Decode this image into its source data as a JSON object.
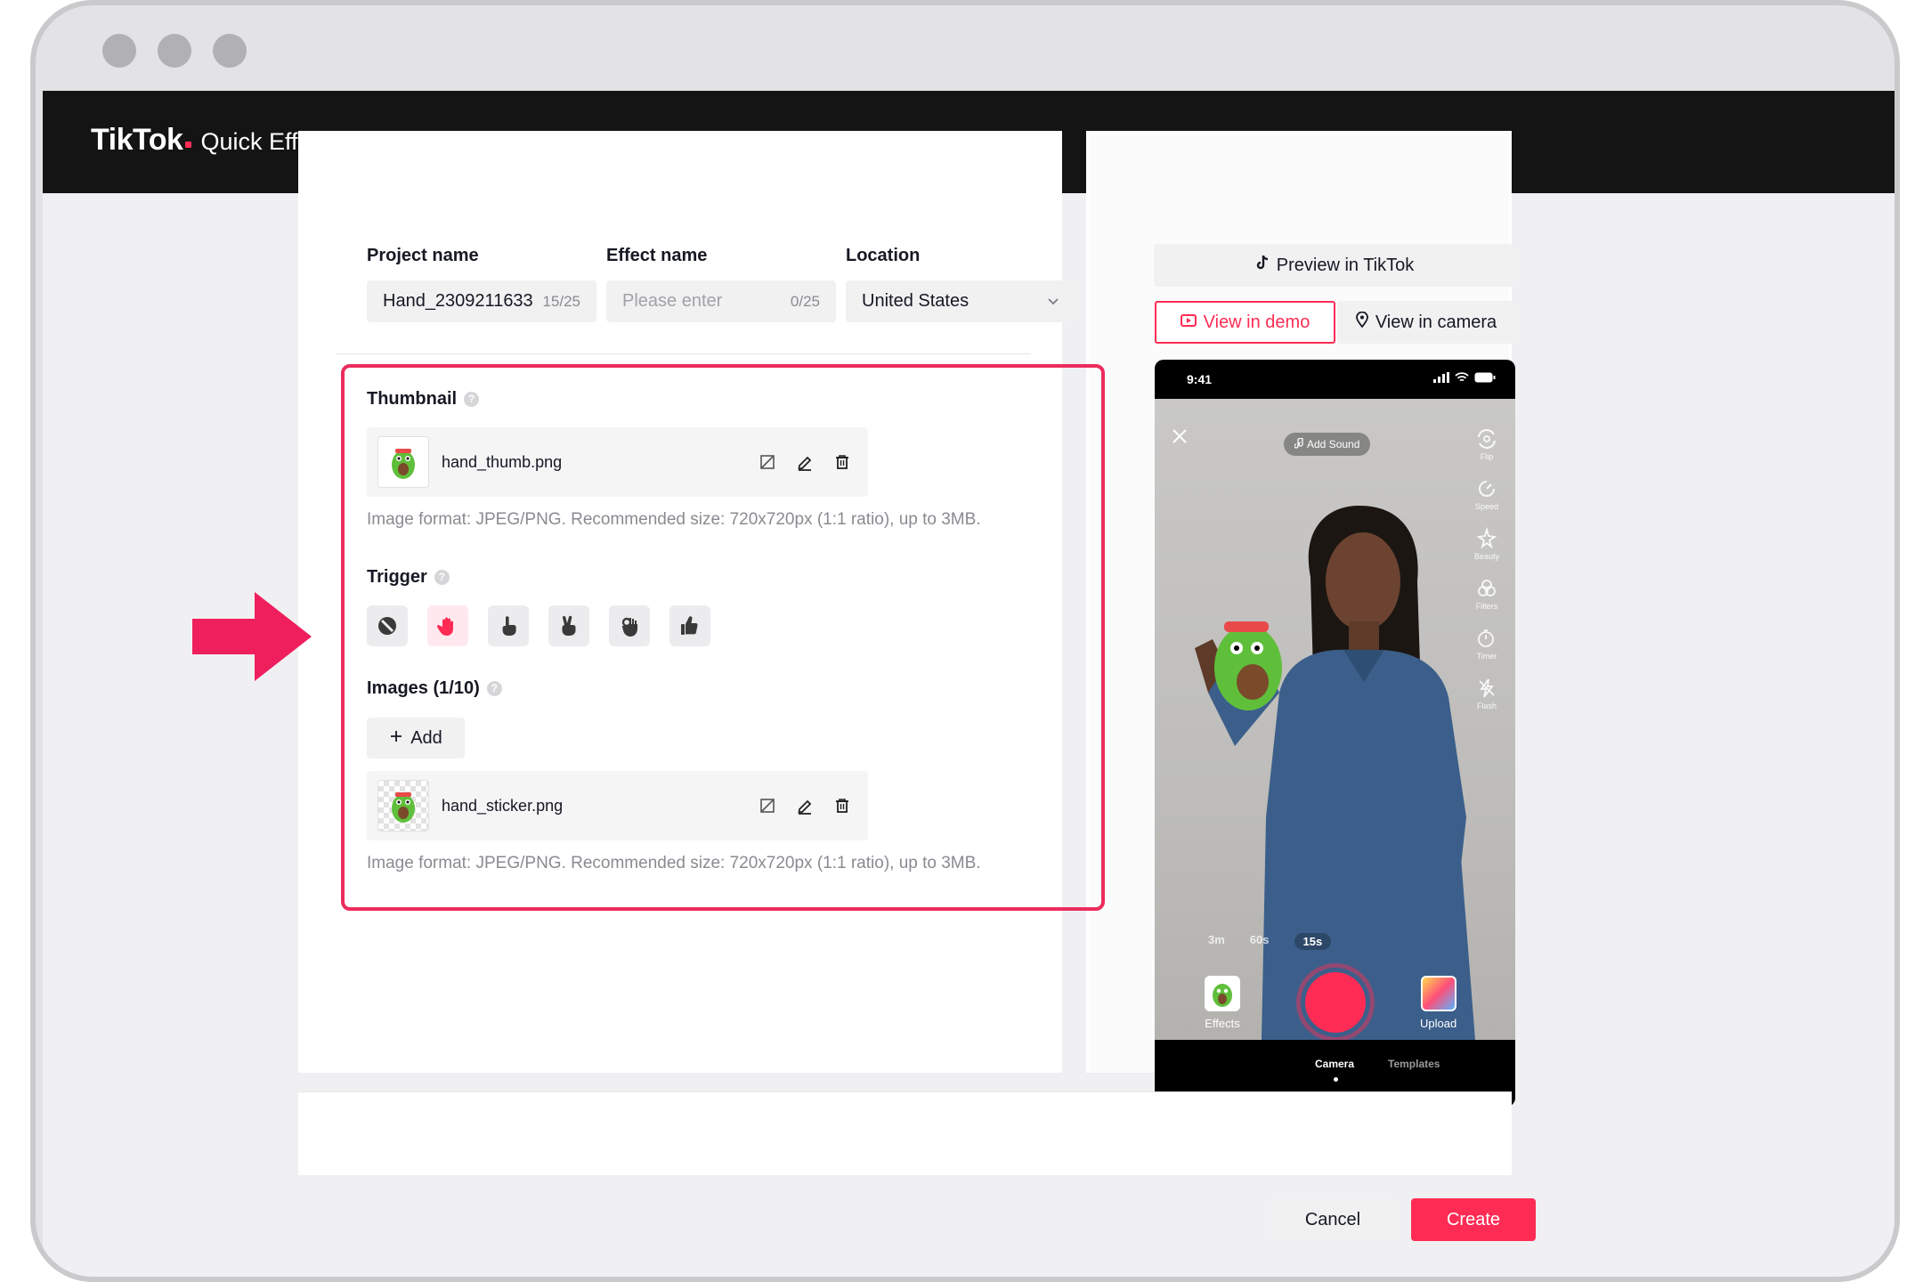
{
  "window": {
    "traffic_lights": [
      "close",
      "minimize",
      "zoom"
    ]
  },
  "header": {
    "logo": "TikTok",
    "subtitle": "Quick Effect"
  },
  "form": {
    "project_name": {
      "label": "Project name",
      "value": "Hand_2309211633",
      "count": "15/25"
    },
    "effect_name": {
      "label": "Effect name",
      "placeholder": "Please enter",
      "count": "0/25"
    },
    "location": {
      "label": "Location",
      "value": "United States"
    },
    "thumbnail": {
      "label": "Thumbnail",
      "file_name": "hand_thumb.png",
      "hint": "Image format: JPEG/PNG. Recommended size: 720x720px (1:1 ratio), up to 3MB."
    },
    "trigger": {
      "label": "Trigger",
      "options": [
        "none-icon",
        "open-hand-icon",
        "point-icon",
        "victory-icon",
        "ok-hand-icon",
        "thumbs-up-icon"
      ],
      "selected": "open-hand-icon"
    },
    "images": {
      "label": "Images (1/10)",
      "add_label": "Add",
      "file_name": "hand_sticker.png",
      "hint": "Image format: JPEG/PNG. Recommended size: 720x720px (1:1 ratio), up to 3MB."
    }
  },
  "preview": {
    "preview_button": "Preview in TikTok",
    "tabs": {
      "demo": "View in demo",
      "camera": "View in camera",
      "active": "demo"
    },
    "phone": {
      "time": "9:41",
      "add_sound": "Add Sound",
      "tools": [
        "Flip",
        "Speed",
        "Beauty",
        "Filters",
        "Timer",
        "Flash"
      ],
      "durations": [
        "3m",
        "60s",
        "15s"
      ],
      "selected_duration": "15s",
      "effects_label": "Effects",
      "upload_label": "Upload",
      "bottom_tabs": [
        "Camera",
        "Templates"
      ],
      "active_tab": "Camera"
    }
  },
  "footer": {
    "cancel": "Cancel",
    "create": "Create"
  },
  "colors": {
    "accent": "#fe2c55",
    "highlight_border": "#ec2c5c",
    "header_bg": "#141414"
  }
}
